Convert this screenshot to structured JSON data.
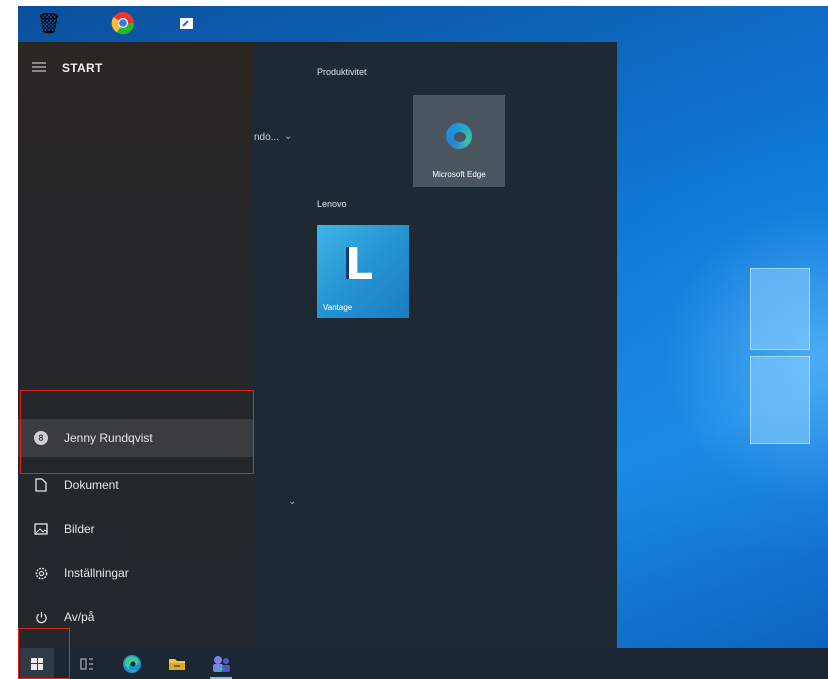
{
  "start_menu": {
    "title": "START",
    "user": {
      "initial": "8",
      "name": "Jenny Rundqvist"
    },
    "items": [
      {
        "label": "Dokument",
        "icon": "document-icon"
      },
      {
        "label": "Bilder",
        "icon": "pictures-icon"
      },
      {
        "label": "Inställningar",
        "icon": "gear-icon"
      },
      {
        "label": "Av/på",
        "icon": "power-icon"
      }
    ],
    "truncated_label": "ndo..."
  },
  "tiles": {
    "group1_label": "Produktivitet",
    "edge_label": "Microsoft Edge",
    "group2_label": "Lenovo",
    "vantage_label": "Vantage",
    "vantage_letter": "L"
  },
  "taskbar": {
    "items": [
      "start-button",
      "task-view",
      "edge",
      "file-explorer",
      "teams"
    ]
  },
  "colors": {
    "highlight": "#e0261c",
    "desktop_blue": "#0f78d6",
    "start_bg": "#1f2a33"
  }
}
